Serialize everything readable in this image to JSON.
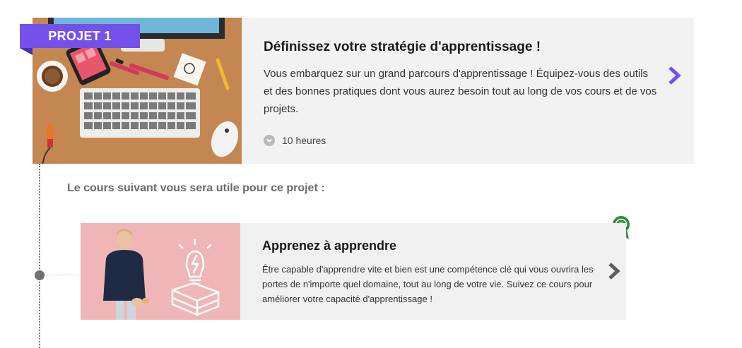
{
  "project": {
    "badge": "PROJET 1",
    "title": "Définissez votre stratégie d'apprentissage !",
    "description": "Vous embarquez sur un grand parcours d'apprentissage ! Équipez-vous des outils et des bonnes pratiques dont vous aurez besoin tout au long de vos cours et de vos projets.",
    "duration": "10 heures"
  },
  "section_heading": "Le cours suivant vous sera utile pour ce projet :",
  "course": {
    "title": "Apprenez à apprendre",
    "description": "Être capable d'apprendre vite et bien est une compétence clé qui vous ouvrira les portes de n'importe quel domaine, tout au long de votre vie. Suivez ce cours pour améliorer votre capacité d'apprentissage !"
  },
  "colors": {
    "accent": "#7451eb",
    "card_background": "#f2f2f2",
    "course_image_background": "#f0b6b7",
    "award_green": "#2e8b3a"
  }
}
